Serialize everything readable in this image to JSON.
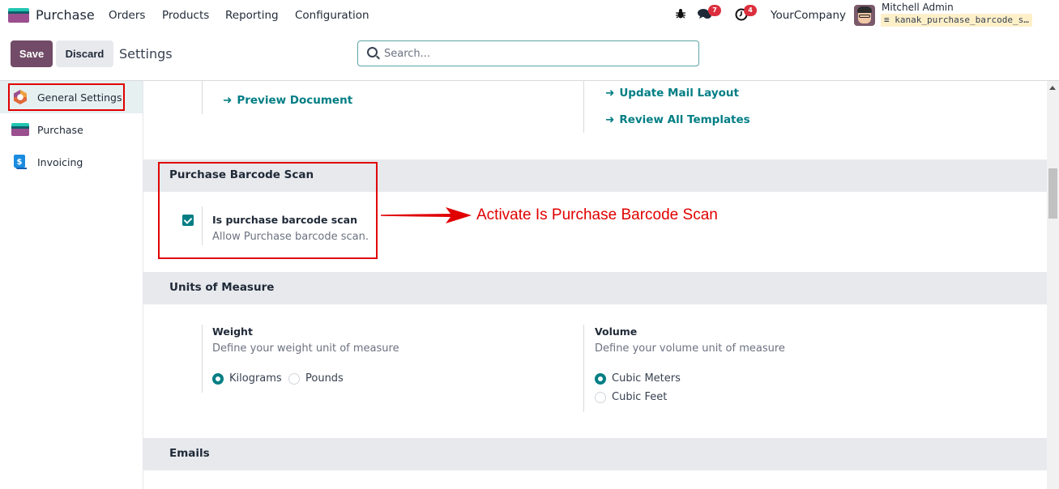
{
  "navbar": {
    "app_name": "Purchase",
    "menu": [
      "Orders",
      "Products",
      "Reporting",
      "Configuration"
    ],
    "icons": [
      "bug-icon",
      "chat-icon",
      "clock-icon"
    ],
    "messages_badge": "7",
    "activities_badge": "4",
    "company": "YourCompany",
    "user_name": "Mitchell Admin",
    "database": "kanak_purchase_barcode_s…"
  },
  "control_panel": {
    "save_label": "Save",
    "discard_label": "Discard",
    "breadcrumb": "Settings",
    "search_placeholder": "Search..."
  },
  "sidebar": {
    "items": [
      {
        "label": "General Settings",
        "active": true
      },
      {
        "label": "Purchase",
        "active": false
      },
      {
        "label": "Invoicing",
        "active": false
      }
    ]
  },
  "main": {
    "links": {
      "preview_document": "Preview Document",
      "update_mail_layout": "Update Mail Layout",
      "review_all_templates": "Review All Templates"
    },
    "sections": {
      "barcode": {
        "title": "Purchase Barcode Scan",
        "setting_title": "Is purchase barcode scan",
        "setting_desc": "Allow Purchase barcode scan.",
        "checked": true
      },
      "uom": {
        "title": "Units of Measure",
        "weight_title": "Weight",
        "weight_desc": "Define your weight unit of measure",
        "weight_options": [
          "Kilograms",
          "Pounds"
        ],
        "weight_selected": "Kilograms",
        "volume_title": "Volume",
        "volume_desc": "Define your volume unit of measure",
        "volume_options": [
          "Cubic Meters",
          "Cubic Feet"
        ],
        "volume_selected": "Cubic Meters"
      },
      "emails": {
        "title": "Emails"
      }
    }
  },
  "annotation": {
    "text": "Activate Is Purchase Barcode Scan",
    "color": "#e00000"
  },
  "colors": {
    "brand": "#714b67",
    "accent": "#017e84",
    "badge": "#dc2f3d"
  }
}
